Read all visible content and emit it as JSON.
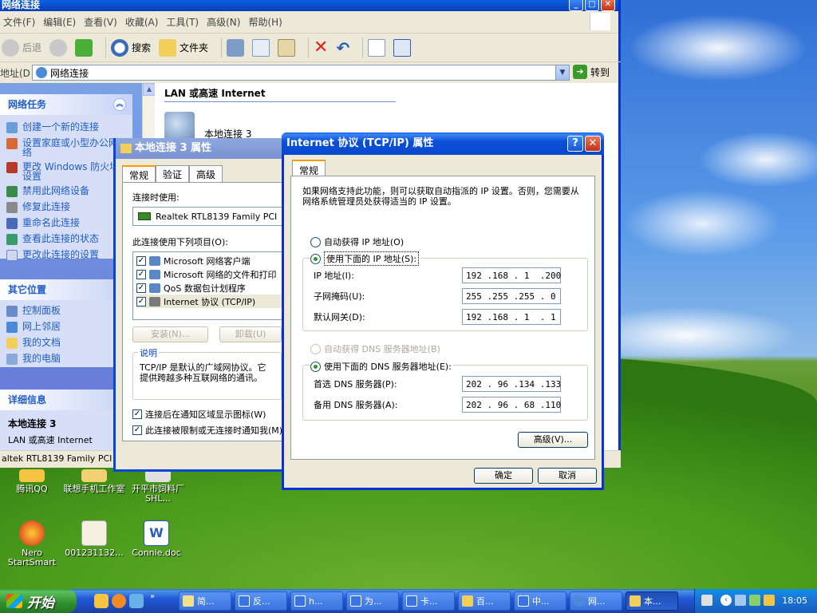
{
  "explorer": {
    "title": "网络连接",
    "menu": [
      "文件(F)",
      "编辑(E)",
      "查看(V)",
      "收藏(A)",
      "工具(T)",
      "高级(N)",
      "帮助(H)"
    ],
    "toolbar": {
      "back": "后退",
      "search": "搜索",
      "folders": "文件夹"
    },
    "address": {
      "label": "地址(D)",
      "value": "网络连接",
      "go": "转到"
    },
    "taskpane": {
      "network_tasks": {
        "title": "网络任务",
        "items": [
          "创建一个新的连接",
          "设置家庭或小型办公网络",
          "更改 Windows 防火墙设置",
          "禁用此网络设备",
          "修复此连接",
          "重命名此连接",
          "查看此连接的状态",
          "更改此连接的设置"
        ]
      },
      "other_places": {
        "title": "其它位置",
        "items": [
          "控制面板",
          "网上邻居",
          "我的文档",
          "我的电脑"
        ]
      },
      "details": {
        "title": "详细信息",
        "name": "本地连接 3",
        "type": "LAN 或高速 Internet"
      }
    },
    "content": {
      "group_header": "LAN 或高速 Internet",
      "connection_name": "本地连接 3"
    },
    "statusbar": "altek RTL8139 Family PCI"
  },
  "props_dialog": {
    "title": "本地连接 3 属性",
    "tabs": [
      "常规",
      "验证",
      "高级"
    ],
    "connect_using_label": "连接时使用:",
    "adapter": "Realtek RTL8139 Family PCI",
    "items_label": "此连接使用下列项目(O):",
    "items": [
      "Microsoft 网络客户端",
      "Microsoft 网络的文件和打印",
      "QoS 数据包计划程序",
      "Internet 协议 (TCP/IP)"
    ],
    "install_button": "安装(N)...",
    "uninstall_button": "卸载(U)",
    "description_label": "说明",
    "description": "TCP/IP 是默认的广域网协议。它提供跨越多种互联网络的通讯。",
    "check_notify": "连接后在通知区域显示图标(W)",
    "check_limited": "此连接被限制或无连接时通知我(M)"
  },
  "tcp_dialog": {
    "title": "Internet 协议 (TCP/IP) 属性",
    "tab": "常规",
    "intro": "如果网络支持此功能，则可以获取自动指派的 IP 设置。否则，您需要从网络系统管理员处获得适当的 IP 设置。",
    "auto_ip": "自动获得 IP 地址(O)",
    "manual_ip": "使用下面的 IP 地址(S):",
    "ip_label": "IP 地址(I):",
    "ip_value": "192 .168 . 1  .200",
    "mask_label": "子网掩码(U):",
    "mask_value": "255 .255 .255 . 0",
    "gateway_label": "默认网关(D):",
    "gateway_value": "192 .168 . 1  . 1",
    "auto_dns": "自动获得 DNS 服务器地址(B)",
    "manual_dns": "使用下面的 DNS 服务器地址(E):",
    "dns1_label": "首选 DNS 服务器(P):",
    "dns1_value": "202 . 96 .134 .133",
    "dns2_label": "备用 DNS 服务器(A):",
    "dns2_value": "202 . 96 . 68 .110",
    "advanced_button": "高级(V)...",
    "ok_button": "确定",
    "cancel_button": "取消"
  },
  "desktop": {
    "icons": [
      "腾讯QQ",
      "联想手机工作室",
      "开平市饲料厂SHL...",
      "Nero StartSmart",
      "001231132...",
      "Connie.doc"
    ]
  },
  "taskbar": {
    "start": "开始",
    "tasks": [
      "简...",
      "反...",
      "h...",
      "为...",
      "卡...",
      "百...",
      "中...",
      "网...",
      "本..."
    ],
    "clock": "18:05"
  }
}
